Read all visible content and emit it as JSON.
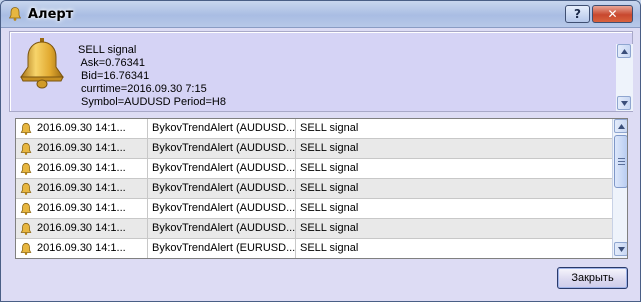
{
  "window": {
    "title": "Алерт",
    "help_label": "?",
    "close_glyph": "✕"
  },
  "message": {
    "text": "SELL signal\n Ask=0.76341\n Bid=16.76341\n currtime=2016.09.30 7:15\n Symbol=AUDUSD Period=H8"
  },
  "alerts": [
    {
      "time": "2016.09.30 14:1...",
      "source": "BykovTrendAlert (AUDUSD...",
      "message": "SELL signal"
    },
    {
      "time": "2016.09.30 14:1...",
      "source": "BykovTrendAlert (AUDUSD...",
      "message": "SELL signal"
    },
    {
      "time": "2016.09.30 14:1...",
      "source": "BykovTrendAlert (AUDUSD...",
      "message": "SELL signal"
    },
    {
      "time": "2016.09.30 14:1...",
      "source": "BykovTrendAlert (AUDUSD...",
      "message": "SELL signal"
    },
    {
      "time": "2016.09.30 14:1...",
      "source": "BykovTrendAlert (AUDUSD...",
      "message": "SELL signal"
    },
    {
      "time": "2016.09.30 14:1...",
      "source": "BykovTrendAlert (AUDUSD...",
      "message": "SELL signal"
    },
    {
      "time": "2016.09.30 14:1...",
      "source": "BykovTrendAlert (EURUSD...",
      "message": "SELL signal"
    }
  ],
  "footer": {
    "close_label": "Закрыть"
  },
  "icons": {
    "title": "bell-icon",
    "message": "bell-icon",
    "row": "bell-icon"
  },
  "colors": {
    "window_bg": "#dddcf4",
    "panel_bg": "#d5d3f5",
    "close_red": "#c8482e",
    "bell_gold": "#e8b53a"
  }
}
